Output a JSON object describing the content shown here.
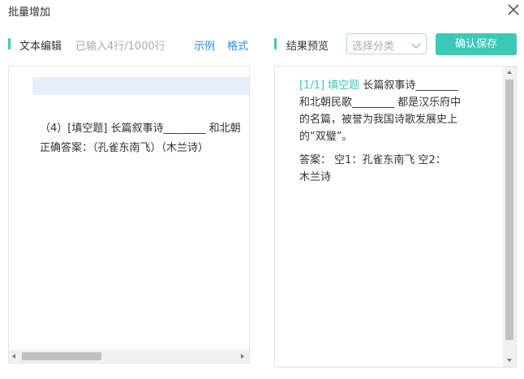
{
  "dialog": {
    "title": "批量增加"
  },
  "editor_section": {
    "label": "文本编辑",
    "counter": "已输入4行/1000行",
    "example_link": "示例",
    "format_link": "格式",
    "lines": [
      "（4）[填空题] 长篇叙事诗________ 和北朝",
      "正确答案：（孔雀东南飞）（木兰诗）"
    ]
  },
  "preview_section": {
    "label": "结果预览",
    "category_placeholder": "选择分类",
    "save_button": "确认保存",
    "question_tag": "[1/1] 填空题",
    "question_lines": [
      "长篇叙事诗________",
      "和北朝民歌________ 都是汉乐府中",
      "的名篇，被誉为我国诗歌发展史上",
      "的“双璧”。"
    ],
    "answer_lines": [
      "答案：    空1：孔雀东南飞    空2：",
      "木兰诗"
    ]
  },
  "colors": {
    "accent": "#3cc9b8",
    "link": "#2d8cf0"
  },
  "icons": {
    "close": "close-icon",
    "select_arrow": "chevron-down-icon"
  }
}
